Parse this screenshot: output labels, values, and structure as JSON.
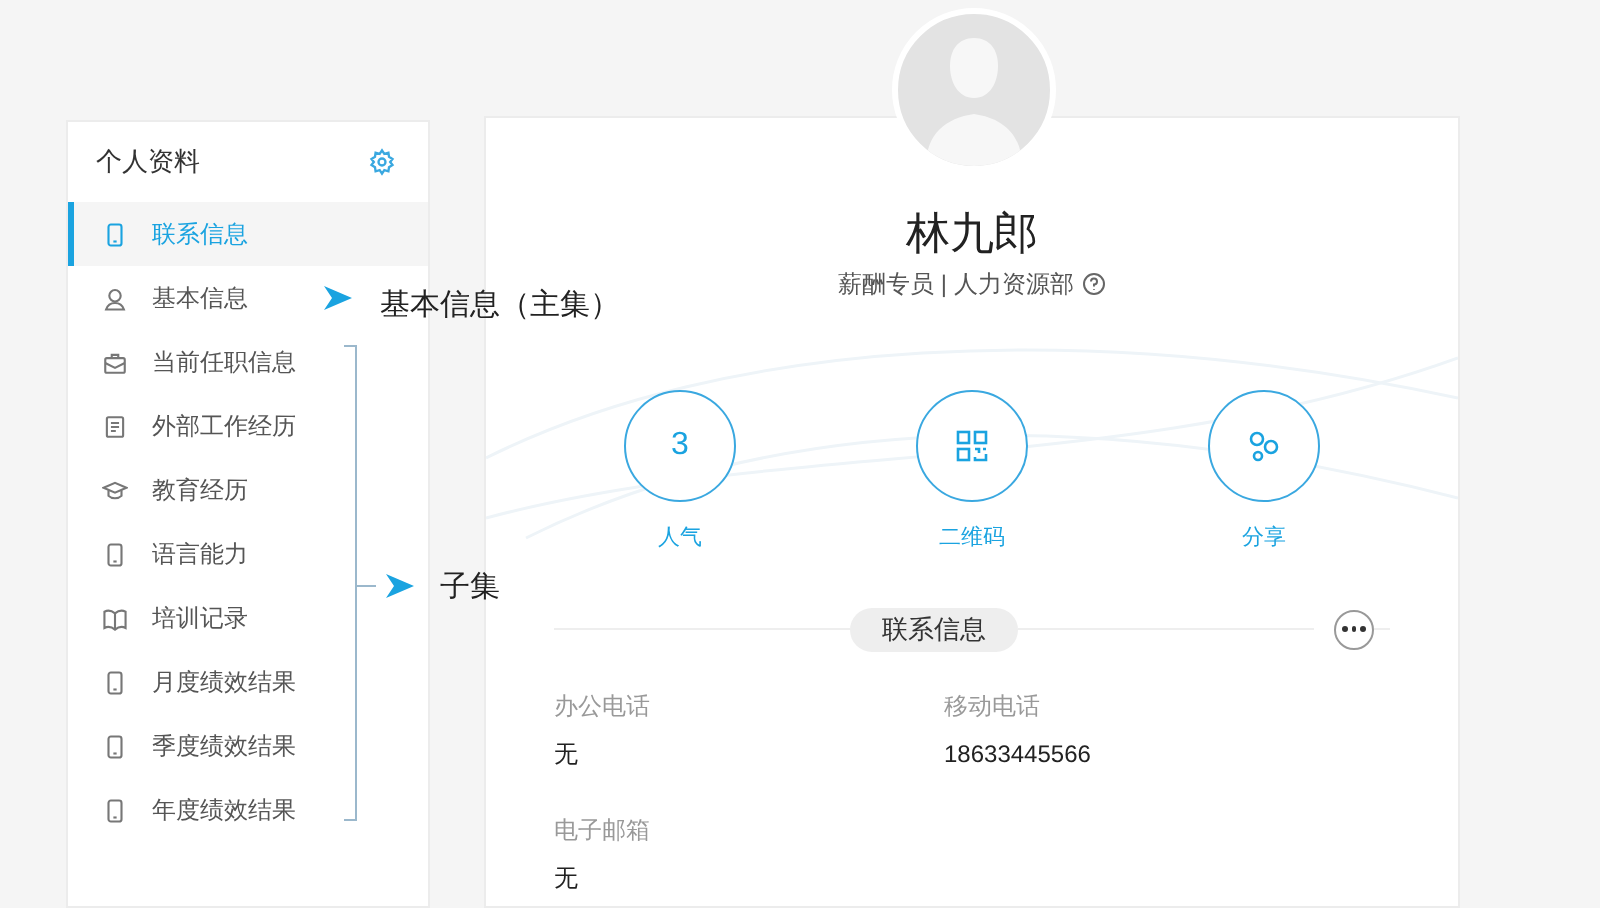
{
  "sidebar": {
    "title": "个人资料",
    "items": [
      {
        "label": "联系信息",
        "kind": "phone",
        "selected": true
      },
      {
        "label": "基本信息",
        "kind": "user",
        "selected": false
      },
      {
        "label": "当前任职信息",
        "kind": "briefcase",
        "selected": false
      },
      {
        "label": "外部工作经历",
        "kind": "document",
        "selected": false
      },
      {
        "label": "教育经历",
        "kind": "cap",
        "selected": false
      },
      {
        "label": "语言能力",
        "kind": "phone",
        "selected": false
      },
      {
        "label": "培训记录",
        "kind": "book",
        "selected": false
      },
      {
        "label": "月度绩效结果",
        "kind": "phone",
        "selected": false
      },
      {
        "label": "季度绩效结果",
        "kind": "phone",
        "selected": false
      },
      {
        "label": "年度绩效结果",
        "kind": "phone",
        "selected": false
      }
    ]
  },
  "annotations": [
    {
      "text": "基本信息（主集）"
    },
    {
      "text": "子集"
    }
  ],
  "profile": {
    "name": "林九郎",
    "subtitle": "薪酬专员 | 人力资源部"
  },
  "stats": [
    {
      "kind": "number",
      "value": "3",
      "label": "人气"
    },
    {
      "kind": "qr",
      "label": "二维码"
    },
    {
      "kind": "share",
      "label": "分享"
    }
  ],
  "section": {
    "title": "联系信息"
  },
  "fields": [
    {
      "label": "办公电话",
      "value": "无"
    },
    {
      "label": "移动电话",
      "value": "18633445566"
    },
    {
      "label": "电子邮箱",
      "value": "无"
    }
  ]
}
